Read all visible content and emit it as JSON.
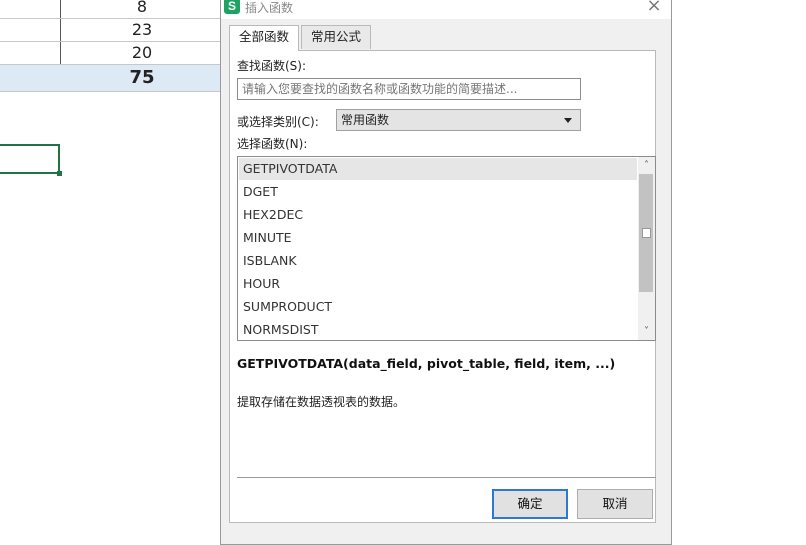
{
  "sheet": {
    "rows": [
      "8",
      "23",
      "20",
      "75"
    ]
  },
  "dialog": {
    "title": "插入函数",
    "app_icon_letter": "S",
    "close_glyph": "×",
    "tabs": [
      "全部函数",
      "常用公式"
    ],
    "search_label": "查找函数(S):",
    "search_placeholder": "请输入您要查找的函数名称或函数功能的简要描述...",
    "category_label": "或选择类别(C):",
    "category_value": "常用函数",
    "function_list_label": "选择函数(N):",
    "functions": [
      "GETPIVOTDATA",
      "DGET",
      "HEX2DEC",
      "MINUTE",
      "ISBLANK",
      "HOUR",
      "SUMPRODUCT",
      "NORMSDIST"
    ],
    "selected_function_index": 0,
    "signature": "GETPIVOTDATA(data_field, pivot_table, field, item, ...)",
    "description": "提取存储在数据透视表的数据。",
    "ok_label": "确定",
    "cancel_label": "取消",
    "scroll_up_glyph": "˄",
    "scroll_down_glyph": "˅"
  },
  "colors": {
    "accent": "#2a7ad0",
    "selection_green": "#217346",
    "total_row_bg": "#dde9f5",
    "app_icon": "#1fa363"
  }
}
